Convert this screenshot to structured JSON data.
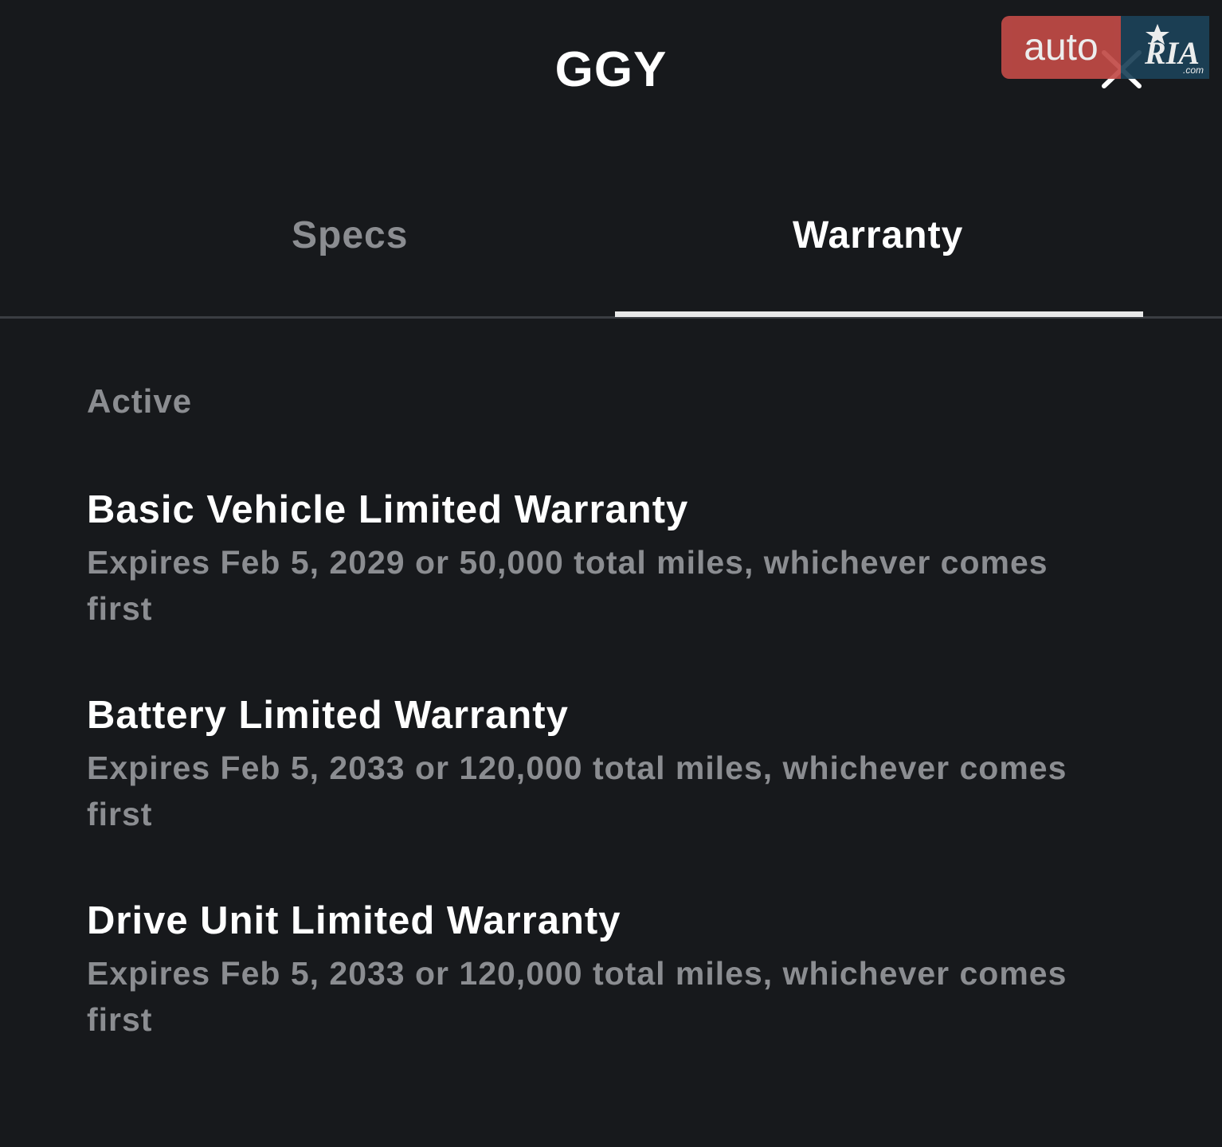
{
  "header": {
    "title": "GGY",
    "close_icon": "close-icon"
  },
  "watermark": {
    "left_text": "auto",
    "right_text": "RIA",
    "suffix": ".com",
    "colors": {
      "red": "#c14a46",
      "navy": "#1c4258"
    }
  },
  "tabs": [
    {
      "label": "Specs",
      "active": false
    },
    {
      "label": "Warranty",
      "active": true
    }
  ],
  "content": {
    "section_label": "Active",
    "warranties": [
      {
        "title": "Basic Vehicle Limited Warranty",
        "description": "Expires Feb 5, 2029 or 50,000 total miles, whichever comes first"
      },
      {
        "title": "Battery Limited Warranty",
        "description": "Expires Feb 5, 2033 or 120,000 total miles, whichever comes first"
      },
      {
        "title": "Drive Unit Limited Warranty",
        "description": "Expires Feb 5, 2033 or 120,000 total miles, whichever comes first"
      }
    ]
  },
  "colors": {
    "background": "#17191c",
    "primary_text": "#ffffff",
    "secondary_text": "#8b8d91",
    "divider": "#3a3d42"
  }
}
